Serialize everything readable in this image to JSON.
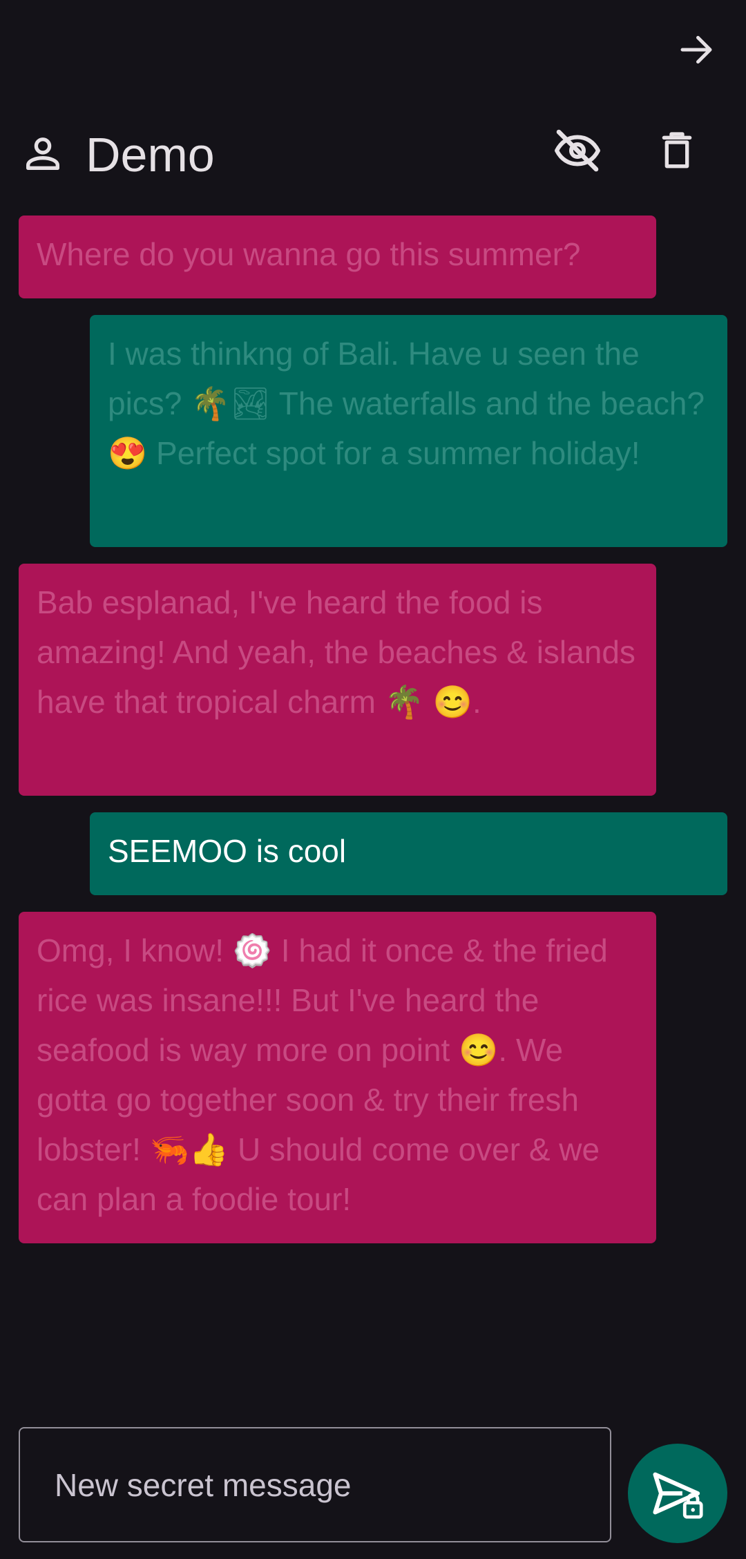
{
  "top_bar": {
    "forward_icon": "arrow-forward-icon"
  },
  "header": {
    "contact_icon": "person-outline-icon",
    "contact_name": "Demo",
    "hide_icon": "eye-off-icon",
    "delete_icon": "trash-icon"
  },
  "messages": [
    {
      "direction": "received",
      "text": "Where do you wanna go this summer?"
    },
    {
      "direction": "sent",
      "text": "I was thinkng of Bali. Have u seen the pics? 🌴🏞 The waterfalls and the beach? 😍 Perfect spot for a summer holiday!"
    },
    {
      "direction": "received",
      "text": "Bab esplanad, I've heard the food is amazing! And yeah, the beaches & islands have that tropical charm 🌴 😊."
    },
    {
      "direction": "sent",
      "text": "SEEMOO is cool"
    },
    {
      "direction": "received",
      "text": "Omg, I know! 🍥 I had it once & the fried rice was insane!!! But I've heard the seafood is way more on point 😊. We gotta go together soon & try their fresh lobster! 🦐👍 U should come over & we can plan a foodie tour!"
    }
  ],
  "composer": {
    "placeholder": "New secret message",
    "value": ""
  },
  "send": {
    "icon": "send-lock-icon"
  },
  "colors": {
    "background": "#141218",
    "received_bubble": "#AD1457",
    "sent_bubble": "#00695C",
    "accent": "#00695C"
  }
}
